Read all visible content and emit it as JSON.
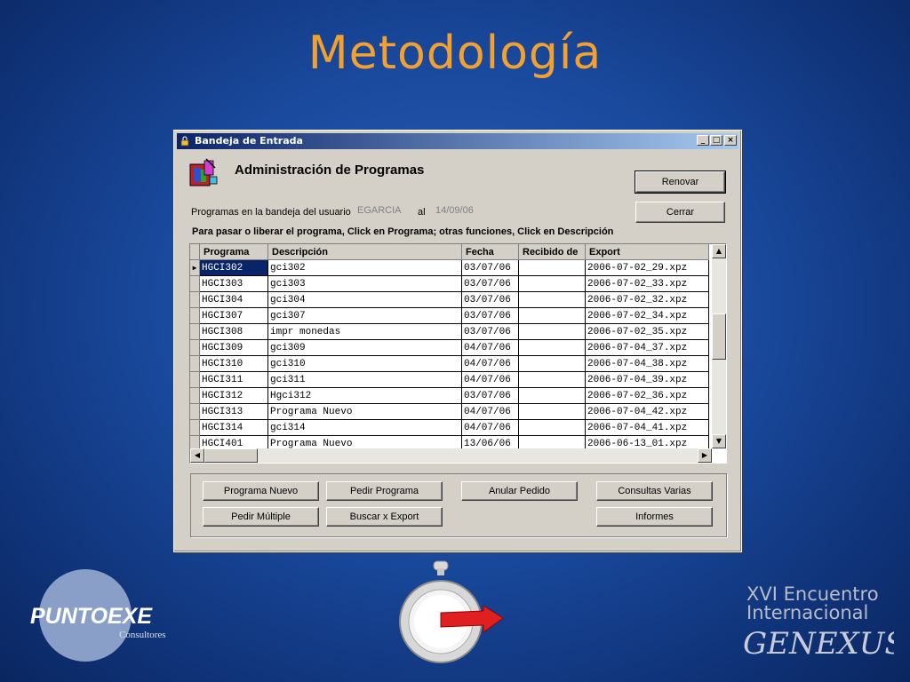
{
  "slide": {
    "title": "Metodología"
  },
  "window": {
    "title": "Bandeja de Entrada",
    "heading": "Administración de Programas",
    "user_label": "Programas en la bandeja del usuario",
    "user_value": "EGARCIA",
    "date_label": "al",
    "date_value": "14/09/06",
    "instructions": "Para pasar o liberar el programa, Click en Programa; otras funciones, Click en Descripción",
    "buttons": {
      "renovar": "Renovar",
      "cerrar": "Cerrar"
    }
  },
  "grid": {
    "columns": [
      "Programa",
      "Descripción",
      "Fecha",
      "Recibido de",
      "Export"
    ],
    "rows": [
      [
        "HGCI302",
        "gci302",
        "03/07/06",
        "",
        "2006-07-02_29.xpz"
      ],
      [
        "HGCI303",
        "gci303",
        "03/07/06",
        "",
        "2006-07-02_33.xpz"
      ],
      [
        "HGCI304",
        "gci304",
        "03/07/06",
        "",
        "2006-07-02_32.xpz"
      ],
      [
        "HGCI307",
        "gci307",
        "03/07/06",
        "",
        "2006-07-02_34.xpz"
      ],
      [
        "HGCI308",
        "impr monedas",
        "03/07/06",
        "",
        "2006-07-02_35.xpz"
      ],
      [
        "HGCI309",
        "gci309",
        "04/07/06",
        "",
        "2006-07-04_37.xpz"
      ],
      [
        "HGCI310",
        "gci310",
        "04/07/06",
        "",
        "2006-07-04_38.xpz"
      ],
      [
        "HGCI311",
        "gci311",
        "04/07/06",
        "",
        "2006-07-04_39.xpz"
      ],
      [
        "HGCI312",
        "Hgci312",
        "03/07/06",
        "",
        "2006-07-02_36.xpz"
      ],
      [
        "HGCI313",
        "Programa Nuevo",
        "04/07/06",
        "",
        "2006-07-04_42.xpz"
      ],
      [
        "HGCI314",
        "gci314",
        "04/07/06",
        "",
        "2006-07-04_41.xpz"
      ],
      [
        "HGCI401",
        "Programa Nuevo",
        "13/06/06",
        "",
        "2006-06-13_01.xpz"
      ]
    ]
  },
  "actions": {
    "programa_nuevo": "Programa Nuevo",
    "pedir_programa": "Pedir Programa",
    "anular_pedido": "Anular Pedido",
    "consultas_varias": "Consultas Varias",
    "pedir_multiple": "Pedir Múltiple",
    "buscar_export": "Buscar x Export",
    "informes": "Informes"
  },
  "logos": {
    "puntoexe_main": "PUNTOEXE",
    "puntoexe_sub": "Consultores",
    "event_line1": "XVI Encuentro",
    "event_line2": "Internacional",
    "event_brand": "GENEXUS"
  },
  "colors": {
    "title": "#f2a130",
    "background": "#1a4a9e",
    "selection": "#0a246a"
  }
}
